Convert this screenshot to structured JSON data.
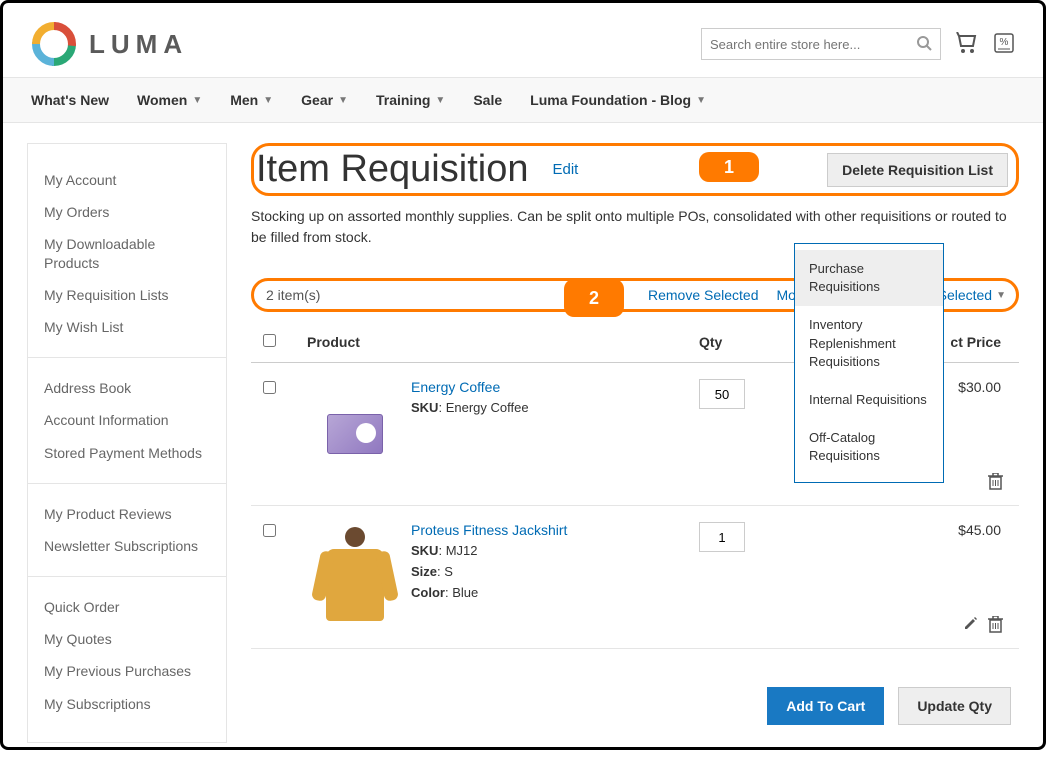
{
  "header": {
    "logo_text": "LUMA",
    "search_placeholder": "Search entire store here..."
  },
  "nav": {
    "whats_new": "What's New",
    "women": "Women",
    "men": "Men",
    "gear": "Gear",
    "training": "Training",
    "sale": "Sale",
    "blog": "Luma Foundation - Blog"
  },
  "sidebar": {
    "group1": {
      "my_account": "My Account",
      "my_orders": "My Orders",
      "downloadable": "My Downloadable Products",
      "requisition_lists": "My Requisition Lists",
      "wish_list": "My Wish List"
    },
    "group2": {
      "address_book": "Address Book",
      "account_info": "Account Information",
      "stored_payment": "Stored Payment Methods"
    },
    "group3": {
      "product_reviews": "My Product Reviews",
      "newsletter": "Newsletter Subscriptions"
    },
    "group4": {
      "quick_order": "Quick Order",
      "my_quotes": "My Quotes",
      "previous_purchases": "My Previous Purchases",
      "my_subscriptions": "My Subscriptions"
    }
  },
  "page": {
    "title": "Item Requisition",
    "edit": "Edit",
    "delete_btn": "Delete Requisition List",
    "callout1": "1",
    "description": "Stocking up on assorted monthly supplies. Can be split onto multiple POs, consolidated with other requisitions or routed to be filled from stock."
  },
  "toolbar": {
    "item_count": "2 item(s)",
    "callout2": "2",
    "remove_selected": "Remove Selected",
    "move_selected": "Move Selected",
    "copy_selected": "Copy Selected"
  },
  "table": {
    "head": {
      "product": "Product",
      "qty": "Qty",
      "price": "ct Price"
    },
    "rows": [
      {
        "name": "Energy Coffee",
        "sku_label": "SKU",
        "sku": "Energy Coffee",
        "qty": "50",
        "price": "$30.00"
      },
      {
        "name": "Proteus Fitness Jackshirt",
        "sku_label": "SKU",
        "sku": "MJ12",
        "size_label": "Size",
        "size": "S",
        "color_label": "Color",
        "color": "Blue",
        "qty": "1",
        "price": "$45.00"
      }
    ]
  },
  "dropdown": {
    "purchase": "Purchase Requisitions",
    "inventory": "Inventory Replenishment Requisitions",
    "internal": "Internal Requisitions",
    "offcatalog": "Off-Catalog Requisitions"
  },
  "footer": {
    "add_to_cart": "Add To Cart",
    "update_qty": "Update Qty"
  }
}
